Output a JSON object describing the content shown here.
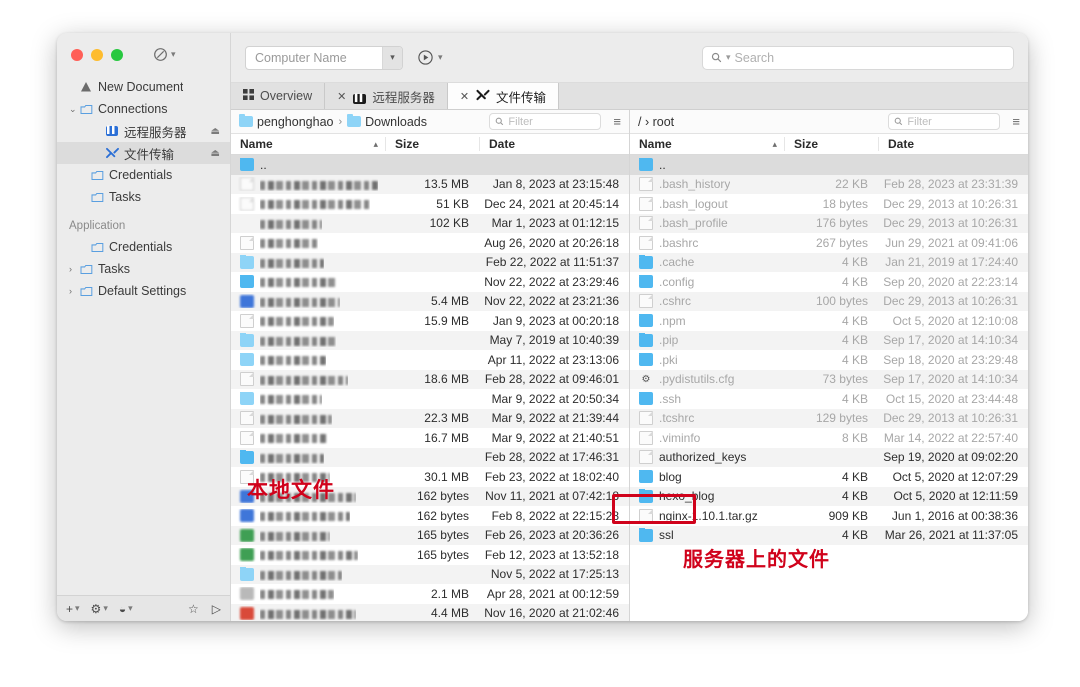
{
  "window": {
    "traffic_lights": [
      "close",
      "minimize",
      "maximize"
    ],
    "toolbar_icon": "compass-icon"
  },
  "sidebar": {
    "items": [
      {
        "label": "New Document",
        "icon": "warning-triangle-icon",
        "indent": 0,
        "twisty": "",
        "selected": false,
        "eject": false
      },
      {
        "label": "Connections",
        "icon": "folder-outline-icon",
        "indent": 0,
        "twisty": "⌄",
        "selected": false,
        "eject": false
      },
      {
        "label": "远程服务器",
        "icon": "terminal-icon",
        "indent": 2,
        "twisty": "",
        "selected": false,
        "eject": true
      },
      {
        "label": "文件传输",
        "icon": "transfer-icon",
        "indent": 2,
        "twisty": "",
        "selected": true,
        "eject": true
      },
      {
        "label": "Credentials",
        "icon": "folder-outline-icon",
        "indent": 1,
        "twisty": "",
        "selected": false,
        "eject": false
      },
      {
        "label": "Tasks",
        "icon": "folder-outline-icon",
        "indent": 1,
        "twisty": "",
        "selected": false,
        "eject": false
      }
    ],
    "group_title": "Application",
    "app_items": [
      {
        "label": "Credentials",
        "icon": "folder-outline-icon",
        "indent": 1,
        "twisty": "",
        "selected": false
      },
      {
        "label": "Tasks",
        "icon": "folder-outline-icon",
        "indent": 0,
        "twisty": "›",
        "selected": false
      },
      {
        "label": "Default Settings",
        "icon": "folder-outline-icon",
        "indent": 0,
        "twisty": "›",
        "selected": false
      }
    ],
    "bottom_bar": {
      "add_icon": "plus-icon",
      "settings_icon": "gear-icon",
      "action_icon": "sync-icon",
      "favorite_icon": "star-icon",
      "run_icon": "play-icon"
    }
  },
  "titlebar": {
    "computer_name_placeholder": "Computer Name",
    "dropdown_icon": "chevron-down-icon",
    "run_icon": "play-circle-icon",
    "run_chevron": "chevron-down-icon",
    "search_placeholder": "Search",
    "search_icon": "search-icon"
  },
  "tabs": [
    {
      "label": "Overview",
      "icon": "grid-icon",
      "closable": false,
      "active": false
    },
    {
      "label": "远程服务器",
      "icon": "terminal-icon",
      "closable": true,
      "active": false
    },
    {
      "label": "文件传输",
      "icon": "transfer-icon",
      "closable": true,
      "active": true
    }
  ],
  "left_pane": {
    "breadcrumb": [
      {
        "label": "penghonghao",
        "icon": "home-folder-icon"
      },
      {
        "label": "Downloads",
        "icon": "downloads-folder-icon"
      }
    ],
    "filter_placeholder": "Filter",
    "filter_icon": "search-icon",
    "view_icon": "list-view-icon",
    "columns": [
      "Name",
      "Size",
      "Date"
    ],
    "sort_column": "Name",
    "sort_direction": "asc",
    "rows": [
      {
        "name": "..",
        "redacted": false,
        "icon": "folder",
        "size": "",
        "date": "",
        "selected": true
      },
      {
        "name": "",
        "redacted": true,
        "redact_w": 118,
        "icon": "doc-mini",
        "size": "13.5 MB",
        "date": "Jan 8, 2023 at 23:15:48"
      },
      {
        "name": "",
        "redacted": true,
        "redact_w": 110,
        "icon": "doc-mini",
        "size": "51 KB",
        "date": "Dec 24, 2021 at 20:45:14"
      },
      {
        "name": "",
        "redacted": true,
        "redact_w": 62,
        "icon": "none",
        "size": "102 KB",
        "date": "Mar 1, 2023 at 01:12:15"
      },
      {
        "name": "",
        "redacted": true,
        "redact_w": 58,
        "icon": "doc",
        "size": "",
        "date": "Aug 26, 2020 at 20:26:18"
      },
      {
        "name": "",
        "redacted": true,
        "redact_w": 64,
        "icon": "folder-lt",
        "size": "",
        "date": "Feb 22, 2022 at 11:51:37"
      },
      {
        "name": "",
        "redacted": true,
        "redact_w": 78,
        "icon": "folder",
        "size": "",
        "date": "Nov 22, 2022 at 23:29:46"
      },
      {
        "name": "",
        "redacted": true,
        "redact_w": 80,
        "icon": "c-blue2",
        "size": "5.4 MB",
        "date": "Nov 22, 2022 at 23:21:36"
      },
      {
        "name": "",
        "redacted": true,
        "redact_w": 74,
        "icon": "doc",
        "size": "15.9 MB",
        "date": "Jan 9, 2023 at 00:20:18"
      },
      {
        "name": "",
        "redacted": true,
        "redact_w": 76,
        "icon": "folder-lt",
        "size": "",
        "date": "May 7, 2019 at 10:40:39"
      },
      {
        "name": "",
        "redacted": true,
        "redact_w": 66,
        "icon": "folder-lt",
        "size": "",
        "date": "Apr 11, 2022 at 23:13:06"
      },
      {
        "name": "",
        "redacted": true,
        "redact_w": 88,
        "icon": "doc",
        "size": "18.6 MB",
        "date": "Feb 28, 2022 at 09:46:01"
      },
      {
        "name": "",
        "redacted": true,
        "redact_w": 62,
        "icon": "folder-lt",
        "size": "",
        "date": "Mar 9, 2022 at 20:50:34"
      },
      {
        "name": "",
        "redacted": true,
        "redact_w": 72,
        "icon": "doc",
        "size": "22.3 MB",
        "date": "Mar 9, 2022 at 21:39:44"
      },
      {
        "name": "",
        "redacted": true,
        "redact_w": 68,
        "icon": "doc",
        "size": "16.7 MB",
        "date": "Mar 9, 2022 at 21:40:51"
      },
      {
        "name": "",
        "redacted": true,
        "redact_w": 64,
        "icon": "folder",
        "size": "",
        "date": "Feb 28, 2022 at 17:46:31"
      },
      {
        "name": "",
        "redacted": true,
        "redact_w": 70,
        "icon": "doc",
        "size": "30.1 MB",
        "date": "Feb 23, 2022 at 18:02:40"
      },
      {
        "name": "",
        "redacted": true,
        "redact_w": 96,
        "icon": "c-blue2",
        "size": "162 bytes",
        "date": "Nov 11, 2021 at 07:42:18"
      },
      {
        "name": "",
        "redacted": true,
        "redact_w": 90,
        "icon": "c-blue2",
        "size": "162 bytes",
        "date": "Feb 8, 2022 at 22:15:28"
      },
      {
        "name": "",
        "redacted": true,
        "redact_w": 70,
        "icon": "c-green",
        "size": "165 bytes",
        "date": "Feb 26, 2023 at 20:36:26"
      },
      {
        "name": "",
        "redacted": true,
        "redact_w": 98,
        "icon": "c-green",
        "size": "165 bytes",
        "date": "Feb 12, 2023 at 13:52:18"
      },
      {
        "name": "",
        "redacted": true,
        "redact_w": 82,
        "icon": "folder-lt",
        "size": "",
        "date": "Nov 5, 2022 at 17:25:13"
      },
      {
        "name": "",
        "redacted": true,
        "redact_w": 74,
        "icon": "c-gray",
        "size": "2.1 MB",
        "date": "Apr 28, 2021 at 00:12:59"
      },
      {
        "name": "",
        "redacted": true,
        "redact_w": 96,
        "icon": "c-red",
        "size": "4.4 MB",
        "date": "Nov 16, 2020 at 21:02:46"
      }
    ]
  },
  "right_pane": {
    "breadcrumb_text": "/ › root",
    "filter_placeholder": "Filter",
    "filter_icon": "search-icon",
    "view_icon": "list-view-icon",
    "columns": [
      "Name",
      "Size",
      "Date"
    ],
    "sort_column": "Name",
    "sort_direction": "asc",
    "rows": [
      {
        "name": "..",
        "icon": "folder",
        "size": "",
        "date": "",
        "selected": true,
        "dim": false
      },
      {
        "name": ".bash_history",
        "icon": "doc",
        "size": "22 KB",
        "date": "Feb 28, 2023 at 23:31:39",
        "dim": true
      },
      {
        "name": ".bash_logout",
        "icon": "doc",
        "size": "18 bytes",
        "date": "Dec 29, 2013 at 10:26:31",
        "dim": true
      },
      {
        "name": ".bash_profile",
        "icon": "doc",
        "size": "176 bytes",
        "date": "Dec 29, 2013 at 10:26:31",
        "dim": true
      },
      {
        "name": ".bashrc",
        "icon": "doc",
        "size": "267 bytes",
        "date": "Jun 29, 2021 at 09:41:06",
        "dim": true
      },
      {
        "name": ".cache",
        "icon": "folder",
        "size": "4 KB",
        "date": "Jan 21, 2019 at 17:24:40",
        "dim": true
      },
      {
        "name": ".config",
        "icon": "folder",
        "size": "4 KB",
        "date": "Sep 20, 2020 at 22:23:14",
        "dim": true
      },
      {
        "name": ".cshrc",
        "icon": "doc",
        "size": "100 bytes",
        "date": "Dec 29, 2013 at 10:26:31",
        "dim": true
      },
      {
        "name": ".npm",
        "icon": "folder",
        "size": "4 KB",
        "date": "Oct 5, 2020 at 12:10:08",
        "dim": true
      },
      {
        "name": ".pip",
        "icon": "folder",
        "size": "4 KB",
        "date": "Sep 17, 2020 at 14:10:34",
        "dim": true
      },
      {
        "name": ".pki",
        "icon": "folder",
        "size": "4 KB",
        "date": "Sep 18, 2020 at 23:29:48",
        "dim": true
      },
      {
        "name": ".pydistutils.cfg",
        "icon": "gear",
        "size": "73 bytes",
        "date": "Sep 17, 2020 at 14:10:34",
        "dim": true
      },
      {
        "name": ".ssh",
        "icon": "folder",
        "size": "4 KB",
        "date": "Oct 15, 2020 at 23:44:48",
        "dim": true
      },
      {
        "name": ".tcshrc",
        "icon": "doc",
        "size": "129 bytes",
        "date": "Dec 29, 2013 at 10:26:31",
        "dim": true
      },
      {
        "name": ".viminfo",
        "icon": "doc",
        "size": "8 KB",
        "date": "Mar 14, 2022 at 22:57:40",
        "dim": true
      },
      {
        "name": "authorized_keys",
        "icon": "doc",
        "size": "",
        "date": "Sep 19, 2020 at 09:02:20",
        "dim": false
      },
      {
        "name": "blog",
        "icon": "folder",
        "size": "4 KB",
        "date": "Oct 5, 2020 at 12:07:29",
        "dim": false
      },
      {
        "name": "hexo_blog",
        "icon": "folder",
        "size": "4 KB",
        "date": "Oct 5, 2020 at 12:11:59",
        "dim": false
      },
      {
        "name": "nginx-1.10.1.tar.gz",
        "icon": "doc",
        "size": "909 KB",
        "date": "Jun 1, 2016 at 00:38:36",
        "dim": false
      },
      {
        "name": "ssl",
        "icon": "folder",
        "size": "4 KB",
        "date": "Mar 26, 2021 at 11:37:05",
        "dim": false,
        "highlighted": true
      }
    ]
  },
  "annotations": {
    "local_label": "本地文件",
    "server_label": "服务器上的文件",
    "highlight_target": "ssl",
    "color": "#d0021b"
  }
}
